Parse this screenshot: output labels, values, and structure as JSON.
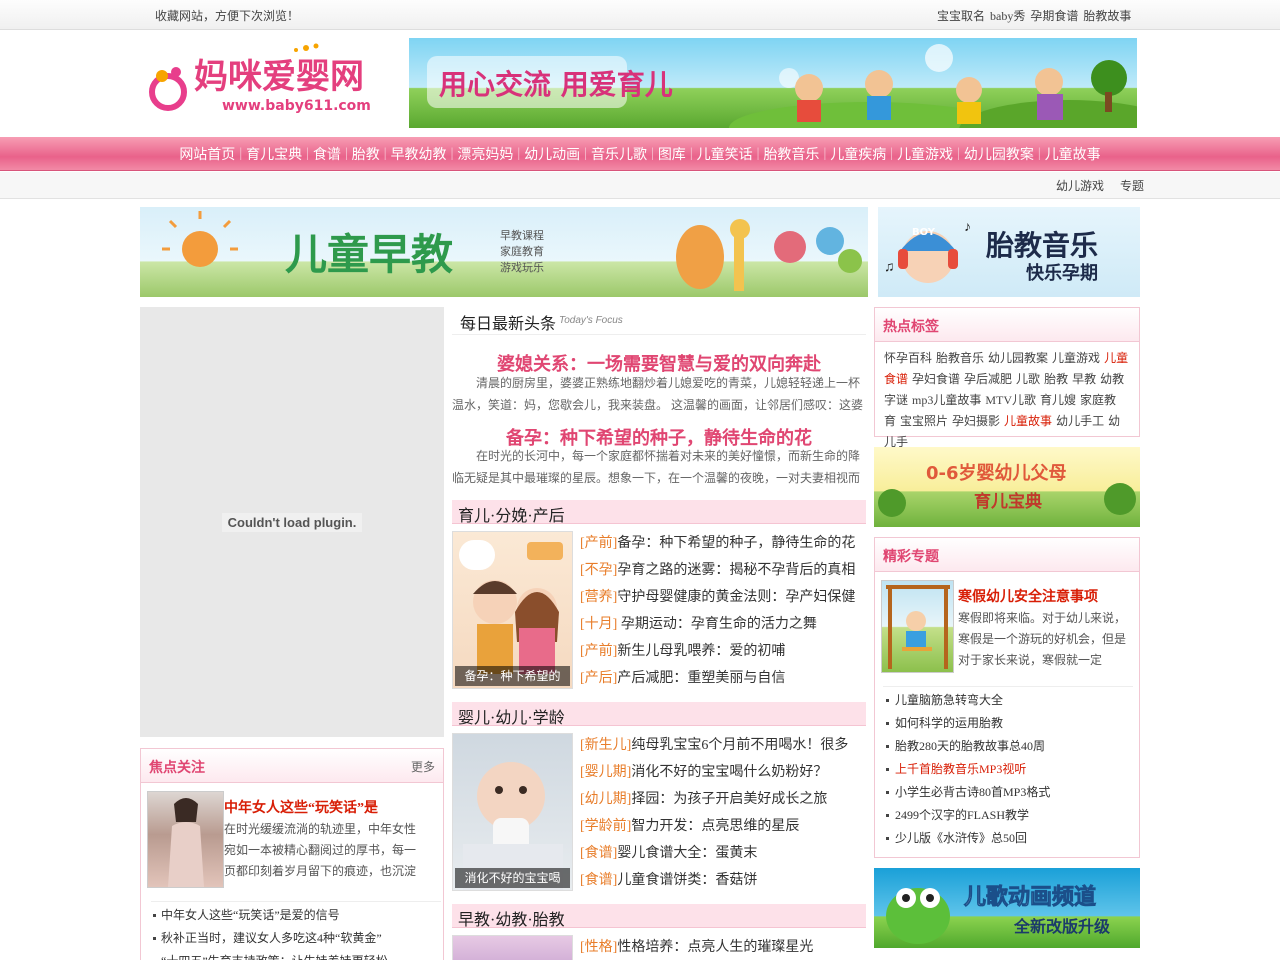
{
  "topbar": {
    "bookmark_text": "收藏网站，方便下次浏览！",
    "links": [
      "宝宝取名",
      "baby秀",
      "孕期食谱",
      "胎教故事"
    ]
  },
  "logo": {
    "text": "妈咪爱婴网",
    "url_text": "www.baby611.com"
  },
  "banner_top": {
    "text": "用心交流  用爱育儿"
  },
  "nav": {
    "items": [
      "网站首页",
      "育儿宝典",
      "食谱",
      "胎教",
      "早教幼教",
      "漂亮妈妈",
      "幼儿动画",
      "音乐儿歌",
      "图库",
      "儿童笑话",
      "胎教音乐",
      "儿童疾病",
      "儿童游戏",
      "幼儿园教案",
      "儿童故事"
    ]
  },
  "subnav": {
    "items": [
      "幼儿游戏",
      "专题"
    ]
  },
  "banner_left": {
    "title": "儿童早教",
    "lines": [
      "早教课程",
      "家庭教育",
      "游戏玩乐"
    ]
  },
  "banner_right": {
    "title": "胎教音乐",
    "subtitle": "快乐孕期",
    "cap": "BOY"
  },
  "plugin": {
    "message": "Couldn't load plugin."
  },
  "focus": {
    "title": "焦点关注",
    "more": "更多",
    "headline": "中年女人这些“玩笑话”是",
    "desc": "在时光缓缓流淌的轨迹里，中年女性宛如一本被精心翻阅过的厚书，每一页都印刻着岁月留下的痕迹，也沉淀",
    "items": [
      "中年女人这些“玩笑话”是爱的信号",
      "秋补正当时，建议女人多吃这4种“软黄金”",
      "“十四五”生育支持政策：让生娃养娃更轻松"
    ]
  },
  "today": {
    "title": "每日最新头条",
    "subtitle": "Today's Focus",
    "items": [
      {
        "headline": "婆媳关系：一场需要智慧与爱的双向奔赴",
        "desc": "清晨的厨房里，婆婆正熟练地翻炒着儿媳爱吃的青菜，儿媳轻轻递上一杯温水，笑道：妈，您歇会儿，我来装盘。 这温馨的画面，让邻居们感叹：这婆"
      },
      {
        "headline": "备孕：种下希望的种子，静待生命的花",
        "desc": "在时光的长河中，每一个家庭都怀揣着对未来的美好憧憬，而新生命的降临无疑是其中最璀璨的星辰。想象一下，在一个温馨的夜晚，一对夫妻相视而"
      }
    ]
  },
  "sections": [
    {
      "title": "育儿·分娩·产后",
      "caption": "备孕：种下希望的",
      "items": [
        {
          "tag": "[产前]",
          "text": "备孕：种下希望的种子，静待生命的花"
        },
        {
          "tag": "[不孕]",
          "text": "孕育之路的迷雾：揭秘不孕背后的真相"
        },
        {
          "tag": "[营养]",
          "text": "守护母婴健康的黄金法则：孕产妇保健"
        },
        {
          "tag": "[十月]",
          "text": " 孕期运动：孕育生命的活力之舞"
        },
        {
          "tag": "[产前]",
          "text": "新生儿母乳喂养：爱的初哺"
        },
        {
          "tag": "[产后]",
          "text": "产后减肥：重塑美丽与自信"
        }
      ]
    },
    {
      "title": "婴儿·幼儿·学龄",
      "caption": "消化不好的宝宝喝",
      "items": [
        {
          "tag": "[新生儿]",
          "text": "纯母乳宝宝6个月前不用喝水！很多"
        },
        {
          "tag": "[婴儿期]",
          "text": "消化不好的宝宝喝什么奶粉好？"
        },
        {
          "tag": "[幼儿期]",
          "text": "择园：为孩子开启美好成长之旅"
        },
        {
          "tag": "[学龄前]",
          "text": "智力开发：点亮思维的星辰"
        },
        {
          "tag": "[食谱]",
          "text": "婴儿食谱大全：蛋黄末"
        },
        {
          "tag": "[食谱]",
          "text": "儿童食谱饼类：香菇饼"
        }
      ]
    },
    {
      "title": "早教·幼教·胎教",
      "items": [
        {
          "tag": "[性格]",
          "text": "性格培养：点亮人生的璀璨星光"
        }
      ]
    }
  ],
  "hot_tags": {
    "title": "热点标签",
    "tags": [
      {
        "t": "怀孕百科"
      },
      {
        "t": "胎教音乐"
      },
      {
        "t": "幼儿园教案"
      },
      {
        "t": "儿童游戏"
      },
      {
        "t": "儿童食谱",
        "red": true
      },
      {
        "t": "孕妇食谱"
      },
      {
        "t": "孕后减肥"
      },
      {
        "t": "儿歌"
      },
      {
        "t": "胎教"
      },
      {
        "t": "早教"
      },
      {
        "t": "幼教"
      },
      {
        "t": "字谜"
      },
      {
        "t": "mp3儿童故事"
      },
      {
        "t": "MTV儿歌"
      },
      {
        "t": "育儿嫂"
      },
      {
        "t": "家庭教育"
      },
      {
        "t": "宝宝照片"
      },
      {
        "t": "孕妇摄影"
      },
      {
        "t": "儿童故事",
        "red": true
      },
      {
        "t": "幼儿手工"
      },
      {
        "t": "幼儿手"
      }
    ]
  },
  "banner_guide": {
    "line1": "0-6岁婴幼儿父母",
    "line2": "育儿宝典"
  },
  "special": {
    "title": "精彩专题",
    "headline": "寒假幼儿安全注意事项",
    "desc": "寒假即将来临。对于幼儿来说，寒假是一个游玩的好机会，但是对于家长来说，寒假就一定",
    "items": [
      {
        "t": "儿童脑筋急转弯大全"
      },
      {
        "t": "如何科学的运用胎教"
      },
      {
        "t": "胎教280天的胎教故事总40周"
      },
      {
        "t": "上千首胎教音乐MP3视听",
        "red": true
      },
      {
        "t": "小学生必背古诗80首MP3格式"
      },
      {
        "t": "2499个汉字的FLASH教学"
      },
      {
        "t": "少儿版《水浒传》总50回"
      }
    ]
  },
  "banner_song": {
    "line1": "儿歌动画频道",
    "line2": "全新改版升级"
  }
}
